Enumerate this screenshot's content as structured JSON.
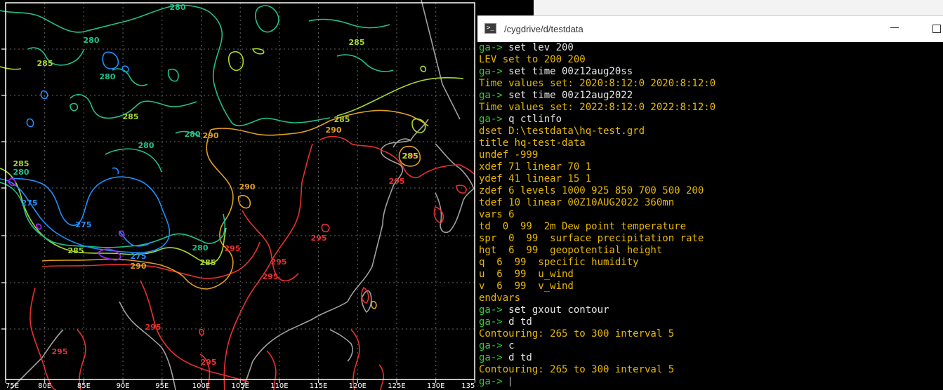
{
  "terminal": {
    "title": "/cygdrive/d/testdata",
    "prompt": "ga->",
    "lines": [
      {
        "type": "cmd",
        "text": "set lev 200"
      },
      {
        "type": "out",
        "text": "LEV set to 200 200"
      },
      {
        "type": "cmd",
        "text": "set time 00z12aug20ss"
      },
      {
        "type": "out",
        "text": "Time values set: 2020:8:12:0 2020:8:12:0"
      },
      {
        "type": "cmd",
        "text": "set time 00z12aug2022"
      },
      {
        "type": "out",
        "text": "Time values set: 2022:8:12:0 2022:8:12:0"
      },
      {
        "type": "cmd",
        "text": "q ctlinfo"
      },
      {
        "type": "out",
        "text": "dset D:\\testdata\\hq-test.grd"
      },
      {
        "type": "out",
        "text": "title hq-test-data"
      },
      {
        "type": "out",
        "text": "undef -999"
      },
      {
        "type": "out",
        "text": "xdef 71 linear 70 1"
      },
      {
        "type": "out",
        "text": "ydef 41 linear 15 1"
      },
      {
        "type": "out",
        "text": "zdef 6 levels 1000 925 850 700 500 200"
      },
      {
        "type": "out",
        "text": "tdef 10 linear 00Z10AUG2022 360mn"
      },
      {
        "type": "out",
        "text": "vars 6"
      },
      {
        "type": "out",
        "text": "td  0  99  2m Dew point temperature"
      },
      {
        "type": "out",
        "text": "spr  0  99  surface precipitation rate"
      },
      {
        "type": "out",
        "text": "hgt  6  99  geopotential height"
      },
      {
        "type": "out",
        "text": "q  6  99  specific humidity"
      },
      {
        "type": "out",
        "text": "u  6  99  u_wind"
      },
      {
        "type": "out",
        "text": "v  6  99  v_wind"
      },
      {
        "type": "out",
        "text": "endvars"
      },
      {
        "type": "cmd",
        "text": "set gxout contour"
      },
      {
        "type": "cmd",
        "text": "d td"
      },
      {
        "type": "out",
        "text": "Contouring: 265 to 300 interval 5"
      },
      {
        "type": "cmd",
        "text": "c"
      },
      {
        "type": "cmd",
        "text": "d td"
      },
      {
        "type": "out",
        "text": "Contouring: 265 to 300 interval 5"
      },
      {
        "type": "cmd",
        "text": ""
      }
    ]
  },
  "plot": {
    "xticks": [
      "75E",
      "80E",
      "85E",
      "90E",
      "95E",
      "100E",
      "105E",
      "110E",
      "115E",
      "120E",
      "125E",
      "130E",
      "135"
    ],
    "contour_labels": [
      {
        "text": "280",
        "level": 280
      },
      {
        "text": "280",
        "level": 280
      },
      {
        "text": "285",
        "level": 285
      },
      {
        "text": "285",
        "level": 285
      },
      {
        "text": "280",
        "level": 280
      },
      {
        "text": "285",
        "level": 285
      },
      {
        "text": "280",
        "level": 280
      },
      {
        "text": "280",
        "level": 280
      },
      {
        "text": "285",
        "level": 285
      },
      {
        "text": "280",
        "level": 280
      },
      {
        "text": "285",
        "level": 285
      },
      {
        "text": "290",
        "level": 290
      },
      {
        "text": "290",
        "level": 290
      },
      {
        "text": "290",
        "level": 290
      },
      {
        "text": "295",
        "level": 295
      },
      {
        "text": "275",
        "level": 275
      },
      {
        "text": "275",
        "level": 275
      },
      {
        "text": "275",
        "level": 275
      },
      {
        "text": "285",
        "level": 285
      },
      {
        "text": "290",
        "level": 290
      },
      {
        "text": "295",
        "level": 295
      },
      {
        "text": "280",
        "level": 280
      },
      {
        "text": "295",
        "level": 295
      },
      {
        "text": "285",
        "level": 285
      },
      {
        "text": "295",
        "level": 295
      },
      {
        "text": "295",
        "level": 295
      },
      {
        "text": "295",
        "level": 295
      },
      {
        "text": "295",
        "level": 295
      },
      {
        "text": "295",
        "level": 295
      },
      {
        "text": "295",
        "level": 295
      },
      {
        "text": "285",
        "level": 285
      }
    ],
    "level_colors": {
      "270": "#a020f0",
      "275": "#1e90ff",
      "280": "#20c08a",
      "285": "#a8d830",
      "290": "#e0a020",
      "295": "#e83030",
      "coast": "#a0a0a0"
    }
  }
}
